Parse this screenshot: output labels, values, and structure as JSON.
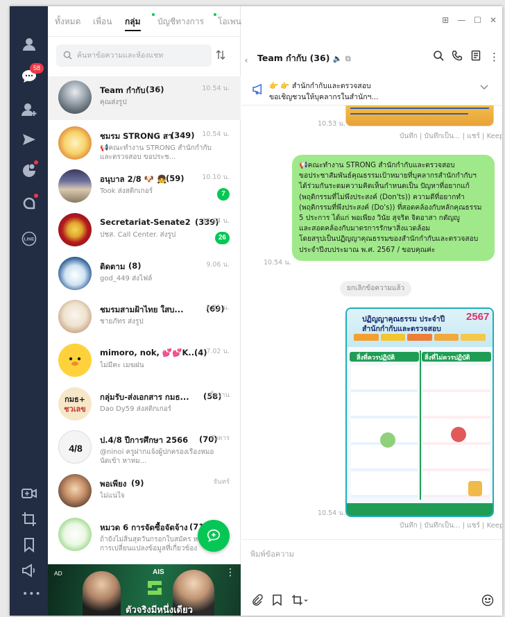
{
  "rail": {
    "chat_badge": "58",
    "icons": [
      "friends-icon",
      "chats-icon",
      "add-friend-icon",
      "keep-icon",
      "timeline-icon",
      "openchat-icon",
      "line-icon",
      "video-call-icon",
      "crop-icon",
      "bookmark-icon",
      "announce-icon",
      "more-icon"
    ]
  },
  "tabs": [
    {
      "label": "ทั้งหมด",
      "active": false,
      "dot": false
    },
    {
      "label": "เพื่อน",
      "active": false,
      "dot": false
    },
    {
      "label": "กลุ่ม",
      "active": true,
      "dot": true
    },
    {
      "label": "บัญชีทางการ",
      "active": false,
      "dot": true
    },
    {
      "label": "โอเพนแชท",
      "active": false,
      "dot": true
    }
  ],
  "search": {
    "placeholder": "ค้นหาข้อความและห้องแชท"
  },
  "chats": [
    {
      "name": "Team กำกับ",
      "count": "(36)",
      "preview": "คุณส่งรูป",
      "time": "10.54 น.",
      "unread": "",
      "selected": true
    },
    {
      "name": "ชมรม STRONG สา",
      "count": "(349)",
      "preview": "📢คณะทำงาน STRONG สำนักกำกับและตรวจสอบ ขอประช...",
      "time": "10.54 น.",
      "unread": "",
      "selected": false
    },
    {
      "name": "อนุบาล 2/8 🐶 👧",
      "count": "(59)",
      "preview": "Took ส่งสติกเกอร์",
      "time": "10.10 น.",
      "unread": "7",
      "selected": false
    },
    {
      "name": "Secretariat-Senate2",
      "count": "(339)",
      "preview": "ปชส. Call Center. ส่งรูป",
      "time": "10.04 น.",
      "unread": "26",
      "selected": false
    },
    {
      "name": "ติดตาม",
      "count": "(8)",
      "preview": "god_449 ส่งไฟล์",
      "time": "9.06 น.",
      "unread": "",
      "selected": false
    },
    {
      "name": "ชมรมสามฝ้าไทย ใสบ...",
      "count": "(69)",
      "preview": "ชายภัทร ส่งรูป",
      "time": "8.21 น.",
      "unread": "",
      "selected": false
    },
    {
      "name": "mimoro, nok, 💕💕K...",
      "count": "(4)",
      "preview": "ไม่มีคะ เมฆฝน",
      "time": "7.02 น.",
      "unread": "",
      "selected": false
    },
    {
      "name": "กลุ่มรับ-ส่งเอกสาร กมธ...",
      "count": "(58)",
      "preview": "Dao Dy59 ส่งสติกเกอร์",
      "time": "เมื่อวาน",
      "unread": "",
      "selected": false
    },
    {
      "name": "ป.4/8 ปีการศึกษา 2566",
      "count": "(70)",
      "preview": "@ninoi ครูฝากแจ้งผู้ปกครองเรื่องหมอนัดเข้า หาหม...",
      "time": "อังคาร",
      "unread": "",
      "selected": false
    },
    {
      "name": "พอเพียง",
      "count": "(9)",
      "preview": "ไม่แน่ใจ",
      "time": "จันทร์",
      "unread": "",
      "selected": false
    },
    {
      "name": "หมวด 6 การจัดซื้อจัดจ้าง",
      "count": "(71)",
      "preview": "ถ้ายังไม่สิ้นสุดวันกรอกใบสมัคร หรือมีการเปลี่ยนแปลงข้อมูลที่เกี่ยวข้อง",
      "time": "",
      "unread": "",
      "selected": false
    }
  ],
  "ad": {
    "label": "AD",
    "brand": "AIS",
    "tagline": "ตัวจริงมีหนึ่งเดียว"
  },
  "chat": {
    "title": "Team กำกับ",
    "count": "(36)",
    "announcement_line1": "👉 👉 สำนักกำกับและตรวจสอบ",
    "announcement_line2": "ขอเชิญชวนให้บุคลากรในสำนักฯ...",
    "messages": {
      "top_time": "10.53 น.",
      "top_actions": "บันทึก | บันทึกเป็น... | แชร์ | Keep",
      "text_time": "10.54 น.",
      "text_lines": [
        "📢คณะทำงาน STRONG สำนักกำกับและตรวจสอบ",
        "ขอประชาสัมพันธ์คุณธรรมเป้าหมายที่บุคลากรสำนักกำกับฯ",
        "ได้ร่วมกันระดมความคิดเห็นกำหนดเป็น ปัญหาที่อยากแก้",
        "(พฤติกรรมที่ไม่พึงประสงค์ (Don'ts)) ความดีที่อยากทำ",
        "(พฤติกรรมที่พึงประสงค์ (Do's)) ที่สอดคล้องกับหลักคุณธรรม",
        "5 ประการ ได้แก่ พอเพียง วินัย สุจริต จิตอาสา กตัญญู",
        "และสอดคล้องกับมาตรการรักษาสิ่งแวดล้อม",
        "โดยสรุปเป็นปฏิญญาคุณธรรมของสำนักกำกับและตรวจสอบ",
        "ประจำปีงบประมาณ พ.ศ. 2567 / ขอบคุณค่ะ"
      ],
      "recall": "ยกเลิกข้อความแล้ว",
      "poster_time": "10.54 น.",
      "poster_title": "ปฏิญญาคุณธรรม ประจำปี",
      "poster_subtitle": "สำนักกำกับและตรวจสอบ",
      "poster_year": "2567",
      "poster_do": "สิ่งที่ควรปฏิบัติ",
      "poster_dont": "สิ่งที่ไม่ควรปฏิบัติ",
      "poster_actions": "บันทึก | บันทึกเป็น... | แชร์ | Keep"
    }
  },
  "composer": {
    "placeholder": "พิมพ์ข้อความ"
  },
  "colors": {
    "accent": "#06c755",
    "rail": "#222c43",
    "bubble": "#a0e98a",
    "badge": "#ec3a47"
  }
}
